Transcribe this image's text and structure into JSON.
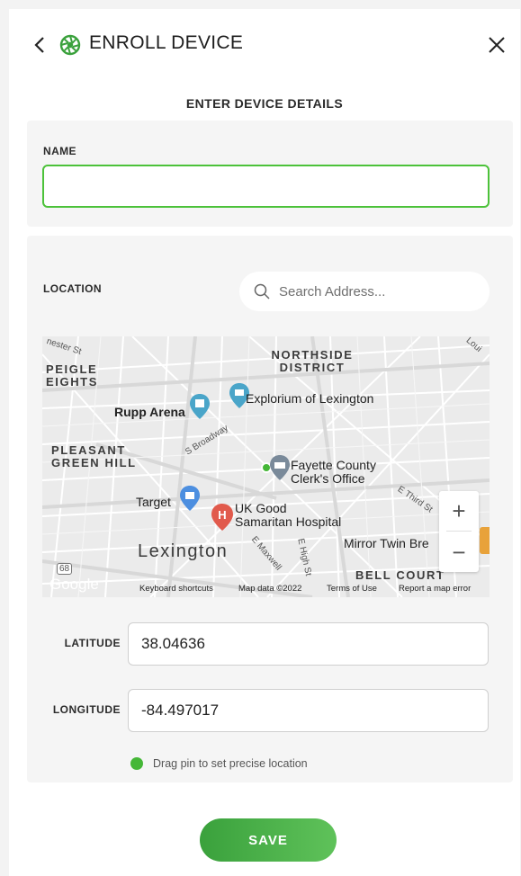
{
  "header": {
    "title": "ENROLL DEVICE",
    "back_icon": "chevron-left-icon",
    "brand_icon": "aperture-icon",
    "close_icon": "close-icon",
    "accent_color": "#3aa13c"
  },
  "form": {
    "section_title": "ENTER DEVICE DETAILS",
    "name": {
      "label": "NAME",
      "value": "",
      "placeholder": ""
    },
    "location": {
      "label": "LOCATION",
      "search_placeholder": "Search Address...",
      "latitude_label": "LATITUDE",
      "latitude_value": "38.04636",
      "longitude_label": "LONGITUDE",
      "longitude_value": "-84.497017",
      "hint": "Drag pin to set precise location"
    },
    "save_label": "SAVE"
  },
  "map": {
    "districts": {
      "northside": "NORTHSIDE DISTRICT",
      "peigle_1": "PEIGLE",
      "peigle_2": "EIGHTS",
      "pleasant_1": "PLEASANT",
      "pleasant_2": "GREEN HILL",
      "bell": "BELL COURT"
    },
    "pois": {
      "explorium": "Explorium of Lexington",
      "rupp": "Rupp Arena",
      "fayette_1": "Fayette County",
      "fayette_2": "Clerk's Office",
      "target": "Target",
      "uk_1": "UK Good",
      "uk_2": "Samaritan Hospital",
      "mirror": "Mirror Twin Bre"
    },
    "city": "Lexington",
    "streets": {
      "chester": "nester St",
      "broadway": "S Broadway",
      "third": "E Third St",
      "maxwell": "E Maxwell",
      "high": "E High St",
      "route": "68",
      "corner": "Loui"
    },
    "zoom_in": "+",
    "zoom_out": "−",
    "google": "Google",
    "footer": {
      "keyboard": "Keyboard shortcuts",
      "map_data": "Map data ©2022",
      "terms": "Terms of Use",
      "report": "Report a map error"
    }
  }
}
